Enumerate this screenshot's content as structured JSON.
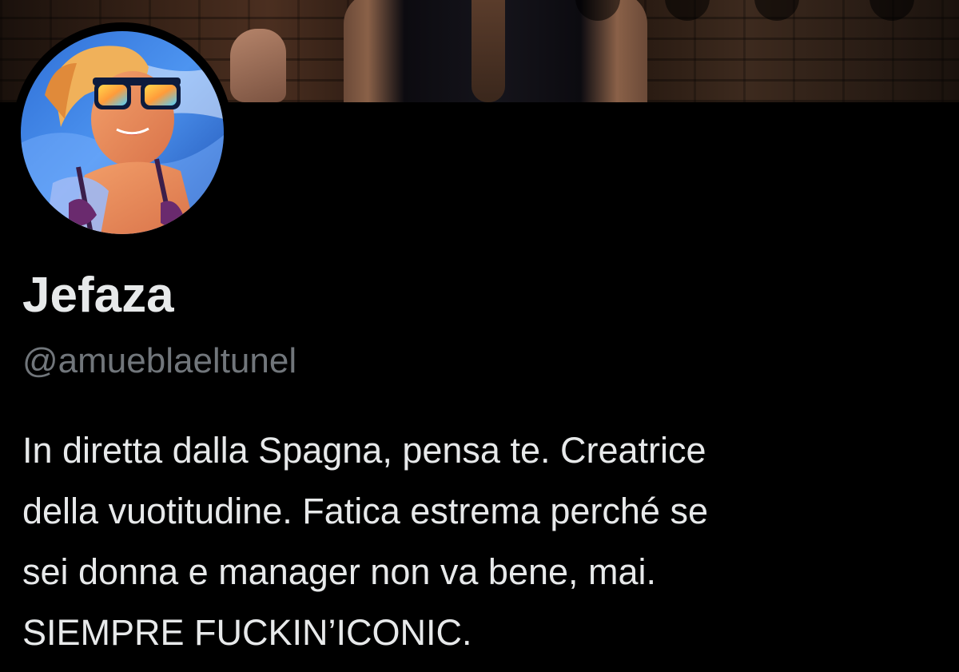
{
  "header": {
    "photo": "header-photo-woman-brick-wall"
  },
  "profile": {
    "avatar": "avatar-woman-blue-sunglasses",
    "display_name": "Jefaza",
    "handle": "@amueblaeltunel",
    "bio_lines": [
      "In diretta dalla Spagna, pensa te. Creatrice",
      "della vuotitudine. Fatica estrema perché se",
      "sei donna e manager non va bene, mai.",
      "SIEMPRE FUCKIN’ICONIC."
    ]
  },
  "colors": {
    "background": "#000000",
    "primary_text": "#e7e9ea",
    "secondary_text": "#71767b"
  }
}
